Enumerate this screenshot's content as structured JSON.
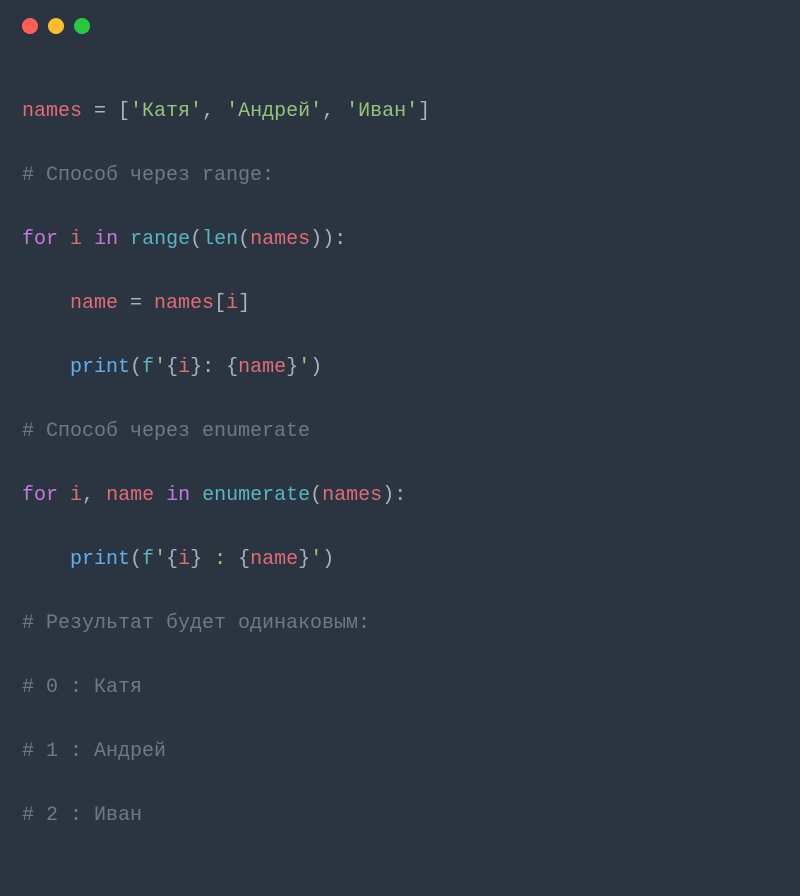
{
  "titlebar": {
    "close_name": "close-icon",
    "minimize_name": "minimize-icon",
    "maximize_name": "maximize-icon"
  },
  "code": {
    "line1": {
      "names": "names",
      "eq": " = ",
      "lb": "[",
      "s1": "'Катя'",
      "c1": ", ",
      "s2": "'Андрей'",
      "c2": ", ",
      "s3": "'Иван'",
      "rb": "]"
    },
    "line2": {
      "comment": "# Способ через range:"
    },
    "line3": {
      "for": "for",
      "sp1": " ",
      "i": "i",
      "sp2": " ",
      "in": "in",
      "sp3": " ",
      "range": "range",
      "lp": "(",
      "len": "len",
      "lp2": "(",
      "names": "names",
      "rp2": ")",
      "rp": "):"
    },
    "line4": {
      "indent": "    ",
      "name": "name",
      "eq": " = ",
      "names": "names",
      "lb": "[",
      "i": "i",
      "rb": "]"
    },
    "line5": {
      "indent": "    ",
      "print": "print",
      "lp": "(",
      "f": "f",
      "q1": "'",
      "lb1": "{",
      "i": "i",
      "rb1": "}",
      "mid": ": ",
      "lb2": "{",
      "nm": "name",
      "rb2": "}",
      "q2": "'",
      "rp": ")"
    },
    "line6": {
      "comment": "# Способ через enumerate"
    },
    "line7": {
      "for": "for",
      "sp1": " ",
      "i": "i",
      "c": ", ",
      "name": "name",
      "sp2": " ",
      "in": "in",
      "sp3": " ",
      "enum": "enumerate",
      "lp": "(",
      "names": "names",
      "rp": "):"
    },
    "line8": {
      "indent": "    ",
      "print": "print",
      "lp": "(",
      "f": "f",
      "q1": "'",
      "lb1": "{",
      "i": "i",
      "rb1": "}",
      "mid": " : ",
      "lb2": "{",
      "nm": "name",
      "rb2": "}",
      "q2": "'",
      "rp": ")"
    },
    "line9": {
      "comment": "# Результат будет одинаковым:"
    },
    "line10": {
      "comment": "# 0 : Катя"
    },
    "line11": {
      "comment": "# 1 : Андрей"
    },
    "line12": {
      "comment": "# 2 : Иван"
    }
  }
}
